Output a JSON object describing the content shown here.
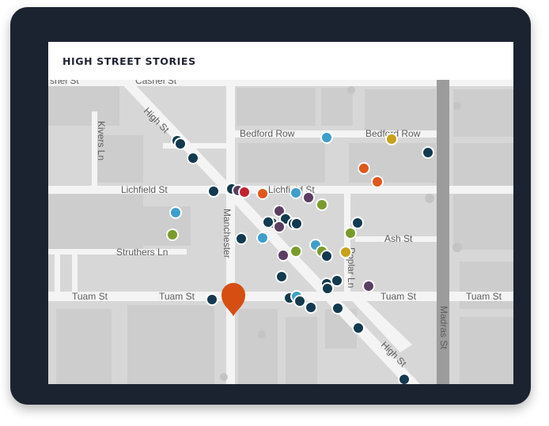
{
  "app": {
    "title": "HIGH STREET STORIES"
  },
  "map": {
    "streets": {
      "casnel_left": "snel St",
      "casnel": "Casnel St",
      "high_st_upper": "High St",
      "high_st_lower": "High St",
      "kivers": "Kivers Ln",
      "bedford_left": "Bedford Row",
      "bedford_right": "Bedford Row",
      "lichfield_left": "Lichfield St",
      "lichfield_right": "Lichfield St",
      "manchester": "Manchester",
      "struthers": "Struthers Ln",
      "ash": "Ash St",
      "poplar": "Poplar Ln",
      "tuam_1": "Tuam St",
      "tuam_2": "Tuam St",
      "tuam_3": "Tuam St",
      "tuam_4": "Tuam St",
      "madras": "Madras St"
    },
    "colors": {
      "navy": "#133a4f",
      "blue": "#3e9fcc",
      "orange": "#e0581c",
      "olive": "#7a9b2c",
      "purple": "#5b3e62",
      "gold": "#c8a11d",
      "red": "#c0222f",
      "pin": "#d64e12"
    },
    "selected_pin_icon": "map-pin-icon",
    "markers": [
      {
        "color": "navy"
      },
      {
        "color": "navy"
      },
      {
        "color": "navy"
      },
      {
        "color": "blue"
      },
      {
        "color": "gold"
      },
      {
        "color": "navy"
      },
      {
        "color": "orange"
      },
      {
        "color": "orange"
      },
      {
        "color": "navy"
      },
      {
        "color": "navy"
      },
      {
        "color": "purple"
      },
      {
        "color": "red"
      },
      {
        "color": "orange"
      },
      {
        "color": "blue"
      },
      {
        "color": "purple"
      },
      {
        "color": "olive"
      },
      {
        "color": "blue"
      },
      {
        "color": "olive"
      },
      {
        "color": "purple"
      },
      {
        "color": "navy"
      },
      {
        "color": "navy"
      },
      {
        "color": "navy"
      },
      {
        "color": "purple"
      },
      {
        "color": "navy"
      },
      {
        "color": "navy"
      },
      {
        "color": "olive"
      },
      {
        "color": "navy"
      },
      {
        "color": "navy"
      },
      {
        "color": "blue"
      },
      {
        "color": "purple"
      },
      {
        "color": "olive"
      },
      {
        "color": "blue"
      },
      {
        "color": "olive"
      },
      {
        "color": "navy"
      },
      {
        "color": "gold"
      },
      {
        "color": "navy"
      },
      {
        "color": "navy"
      },
      {
        "color": "navy"
      },
      {
        "color": "navy"
      },
      {
        "color": "purple"
      },
      {
        "color": "navy"
      },
      {
        "color": "blue"
      },
      {
        "color": "navy"
      },
      {
        "color": "navy"
      },
      {
        "color": "navy"
      },
      {
        "color": "navy"
      },
      {
        "color": "navy"
      },
      {
        "color": "navy"
      }
    ]
  }
}
